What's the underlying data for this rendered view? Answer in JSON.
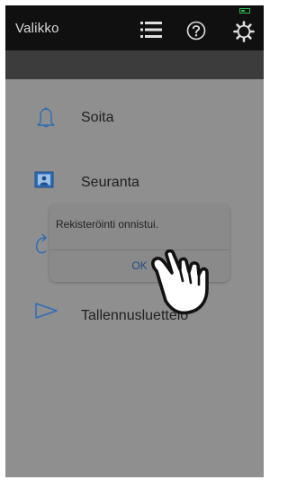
{
  "header": {
    "title": "Valikko",
    "icons": [
      "list-icon",
      "help-icon",
      "settings-icon"
    ]
  },
  "menu": {
    "items": [
      {
        "label": "Soita",
        "icon": "bell-icon"
      },
      {
        "label": "Seuranta",
        "icon": "monitor-icon"
      },
      {
        "label": "",
        "icon": "refresh-icon"
      },
      {
        "label": "Tallennusluettelo",
        "icon": "play-icon"
      }
    ]
  },
  "dialog": {
    "message": "Rekisteröinti onnistui.",
    "ok_label": "OK"
  },
  "colors": {
    "topbar": "#101010",
    "background": "#8f8f8f",
    "dialog": "#8a8a8a",
    "ok_text": "#234a86",
    "icon_blue": "#2d6db5"
  }
}
